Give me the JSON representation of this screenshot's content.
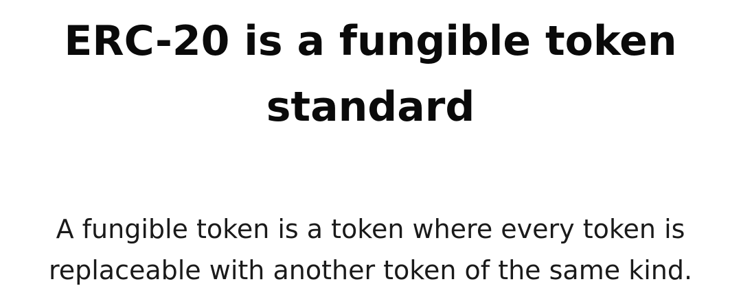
{
  "slide": {
    "title_lines": [
      "ERC-20 is a fungible token",
      "standard"
    ],
    "body_lines": [
      "A fungible token is a token where every token is",
      "replaceable with another token of the same kind."
    ]
  }
}
